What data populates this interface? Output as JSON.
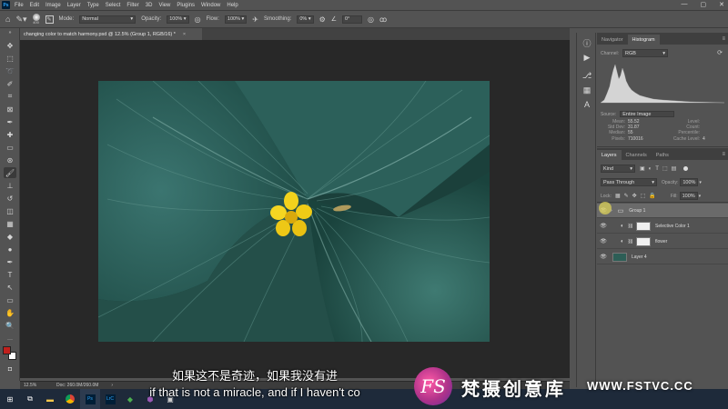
{
  "menu": [
    "File",
    "Edit",
    "Image",
    "Layer",
    "Type",
    "Select",
    "Filter",
    "3D",
    "View",
    "Plugins",
    "Window",
    "Help"
  ],
  "window_controls": [
    "—",
    "▢",
    "✕"
  ],
  "options": {
    "brush_size": "400",
    "mode_label": "Mode:",
    "mode_value": "Normal",
    "opacity_label": "Opacity:",
    "opacity_value": "100%",
    "flow_label": "Flow:",
    "flow_value": "100%",
    "smoothing_label": "Smoothing:",
    "smoothing_value": "0%",
    "angle_value": "0°"
  },
  "document_tab": {
    "title": "changing color to match harmony.psd @ 12.5% (Group 1, RGB/16) *",
    "close": "×"
  },
  "status": {
    "zoom": "12.5%",
    "doc": "Doc: 260.0M/260.0M",
    "arrow": "›"
  },
  "panels": {
    "top_tabs": [
      "Navigator",
      "Histogram"
    ],
    "top_active": "Histogram",
    "channel_label": "Channel:",
    "channel_value": "RGB",
    "source_label": "Source:",
    "source_value": "Entire Image",
    "stats": [
      {
        "l": "Mean:",
        "v": "55.52",
        "l2": "Level:",
        "v2": ""
      },
      {
        "l": "Std Dev:",
        "v": "31.87",
        "l2": "Count:",
        "v2": ""
      },
      {
        "l": "Median:",
        "v": "55",
        "l2": "Percentile:",
        "v2": ""
      },
      {
        "l": "Pixels:",
        "v": "710016",
        "l2": "Cache Level:",
        "v2": "4"
      }
    ],
    "layer_tabs": [
      "Layers",
      "Channels",
      "Paths"
    ],
    "layer_active": "Layers",
    "kind_value": "Kind",
    "blend_value": "Pass Through",
    "opacity_label": "Opacity:",
    "opacity_value": "100%",
    "lock_label": "Lock:",
    "fill_label": "Fill:",
    "fill_value": "100%",
    "layers": [
      {
        "name": "Group 1",
        "type": "group"
      },
      {
        "name": "Selective Color 1",
        "type": "adjustment"
      },
      {
        "name": "flower",
        "type": "adjustment"
      },
      {
        "name": "Layer 4",
        "type": "image"
      }
    ]
  },
  "subtitles": {
    "cn": "如果这不是奇迹，如果我没有进",
    "en": "if that is not a miracle, and if I haven't co"
  },
  "watermark": {
    "logo": "FS",
    "cn": "梵摄创意库",
    "url": "WWW.FSTVC.CC"
  },
  "colors": {
    "accent": "#31a8ff",
    "fg_swatch": "#c0201c",
    "bg_swatch": "#ffffff",
    "flower": "#f2cf1c",
    "leaf": "#2a5e58"
  }
}
